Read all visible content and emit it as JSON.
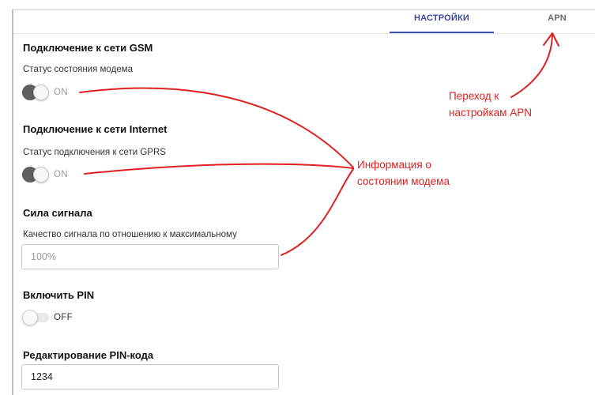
{
  "tabs": [
    {
      "label": "НАСТРОЙКИ",
      "active": true
    },
    {
      "label": "APN",
      "active": false
    }
  ],
  "gsm": {
    "title": "Подключение к сети GSM",
    "field_label": "Статус состояния модема",
    "toggle_state": "ON",
    "enabled": true
  },
  "internet": {
    "title": "Подключение к сети Internet",
    "field_label": "Статус подключения к сети GPRS",
    "toggle_state": "ON",
    "enabled": true
  },
  "signal": {
    "title": "Сила сигнала",
    "field_label": "Качество сигнала по отношению к максимальному",
    "value": "100%"
  },
  "pin": {
    "title": "Включить PIN",
    "toggle_state": "OFF",
    "enabled": false
  },
  "pin_edit": {
    "title": "Редактирование PIN-кода",
    "value": "1234"
  },
  "annotations": {
    "apn_line1": "Переход к",
    "apn_line2": "настройкам APN",
    "modem_line1": "Информация о",
    "modem_line2": "состоянии модема",
    "color": "#e02020"
  },
  "colors": {
    "accent": "#3f51b5",
    "tab_active_text": "#3a4a9b"
  }
}
